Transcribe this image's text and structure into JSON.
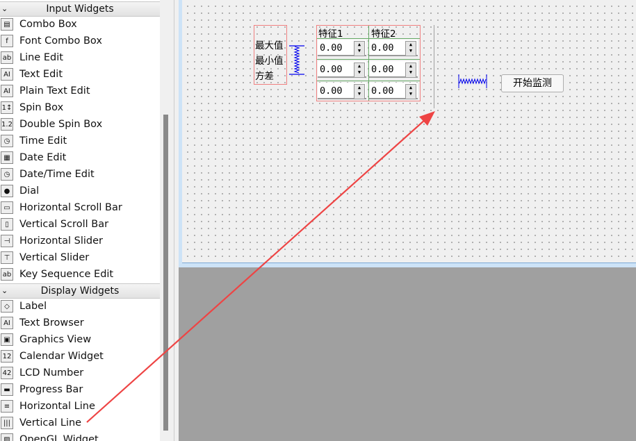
{
  "widget_box": {
    "input_header": "Input Widgets",
    "input_items": [
      "Combo Box",
      "Font Combo Box",
      "Line Edit",
      "Text Edit",
      "Plain Text Edit",
      "Spin Box",
      "Double Spin Box",
      "Time Edit",
      "Date Edit",
      "Date/Time Edit",
      "Dial",
      "Horizontal Scroll Bar",
      "Vertical Scroll Bar",
      "Horizontal Slider",
      "Vertical Slider",
      "Key Sequence Edit"
    ],
    "display_header": "Display Widgets",
    "display_items": [
      "Label",
      "Text Browser",
      "Graphics View",
      "Calendar Widget",
      "LCD Number",
      "Progress Bar",
      "Horizontal Line",
      "Vertical Line",
      "OpenGL Widget"
    ]
  },
  "form": {
    "labels": [
      "最大值",
      "最小值",
      "方差"
    ],
    "columns": [
      "特征1",
      "特征2"
    ],
    "values": [
      [
        "0.00",
        "0.00"
      ],
      [
        "0.00",
        "0.00"
      ],
      [
        "0.00",
        "0.00"
      ]
    ],
    "start_button": "开始监测"
  },
  "colors": {
    "annotation_arrow": "#ee4444",
    "layout_border": "#f08080",
    "spacer": "#0000ee"
  }
}
